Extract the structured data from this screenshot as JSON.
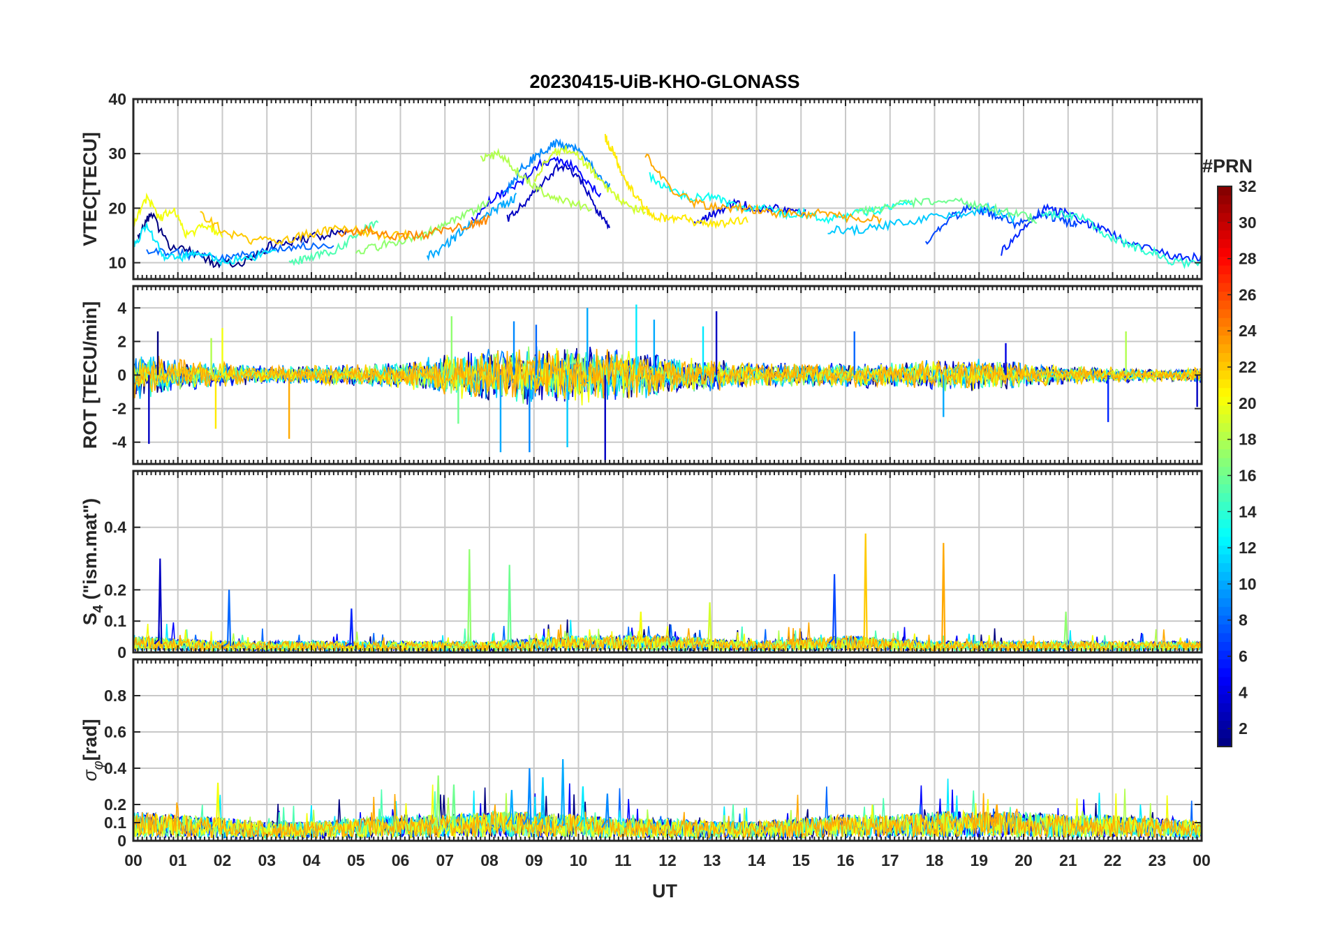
{
  "chart_data": {
    "type": "line",
    "title": "20230415-UiB-KHO-GLONASS",
    "xlabel": "UT",
    "x_tick_labels": [
      "00",
      "01",
      "02",
      "03",
      "04",
      "05",
      "06",
      "07",
      "08",
      "09",
      "10",
      "11",
      "12",
      "13",
      "14",
      "15",
      "16",
      "17",
      "18",
      "19",
      "20",
      "21",
      "22",
      "23",
      "00"
    ],
    "x_range_hours": [
      0,
      24
    ],
    "grid": true,
    "colorbar": {
      "title": "#PRN",
      "colormap": "jet",
      "range": [
        1,
        32
      ],
      "tick_labels": [
        "2",
        "4",
        "6",
        "8",
        "10",
        "12",
        "14",
        "16",
        "18",
        "20",
        "22",
        "24",
        "26",
        "28",
        "30",
        "32"
      ]
    },
    "panels": [
      {
        "ylabel": "VTEC[TECU]",
        "ylim": [
          7,
          40
        ],
        "y_ticks": [
          10,
          20,
          30,
          40
        ],
        "y_tick_labels": [
          "10",
          "20",
          "30",
          "40"
        ],
        "series": [
          {
            "prn": 1,
            "x": [
              0.1,
              0.4,
              0.8,
              1.3,
              1.8,
              2.4,
              3.0
            ],
            "y": [
              15,
              19,
              13,
              12,
              10,
              10,
              12
            ]
          },
          {
            "prn": 2,
            "x": [
              3.0,
              3.6,
              4.2,
              4.8
            ],
            "y": [
              13,
              14,
              15,
              16
            ]
          },
          {
            "prn": 3,
            "x": [
              8.4,
              8.8,
              9.2,
              9.6,
              10.0,
              10.4,
              10.7
            ],
            "y": [
              18,
              21,
              25,
              28,
              26,
              20,
              16
            ]
          },
          {
            "prn": 4,
            "x": [
              12.6,
              13.0,
              13.5,
              14.0,
              14.6,
              15.1
            ],
            "y": [
              17,
              19,
              21,
              20,
              20,
              19
            ]
          },
          {
            "prn": 5,
            "x": [
              7.6,
              8.1,
              8.6,
              9.1,
              9.6,
              10.0,
              10.5
            ],
            "y": [
              18,
              22,
              24,
              28,
              29,
              27,
              22
            ]
          },
          {
            "prn": 6,
            "x": [
              19.5,
              20.0,
              20.5,
              21.0,
              21.5,
              22.0,
              22.6,
              23.4,
              24.0
            ],
            "y": [
              12,
              16,
              20,
              19,
              17,
              15,
              13,
              11,
              11
            ]
          },
          {
            "prn": 7,
            "x": [
              17.8,
              18.3,
              18.8,
              19.3,
              19.8,
              20.3,
              20.8,
              21.2
            ],
            "y": [
              14,
              18,
              20,
              19,
              17,
              19,
              18,
              17
            ]
          },
          {
            "prn": 8,
            "x": [
              0.3,
              0.9,
              1.6,
              2.3,
              3.0,
              3.7,
              4.5
            ],
            "y": [
              12,
              12,
              11,
              11,
              12,
              13,
              13
            ]
          },
          {
            "prn": 9,
            "x": [
              8.3,
              8.7,
              9.1,
              9.5,
              9.9,
              10.3,
              10.7
            ],
            "y": [
              22,
              27,
              30,
              32,
              31,
              28,
              24
            ]
          },
          {
            "prn": 10,
            "x": [
              6.6,
              7.0,
              7.4,
              7.8,
              8.2,
              8.6
            ],
            "y": [
              11,
              13,
              16,
              18,
              20,
              22
            ]
          },
          {
            "prn": 11,
            "x": [
              15.6,
              16.3,
              17.0,
              17.7,
              18.5,
              19.2,
              19.8
            ],
            "y": [
              16,
              16,
              17,
              18,
              19,
              20,
              18
            ]
          },
          {
            "prn": 12,
            "x": [
              0.0,
              0.3,
              0.7,
              1.1,
              1.5,
              2.0,
              2.6,
              3.2
            ],
            "y": [
              13,
              17,
              11,
              11,
              12,
              10,
              11,
              12
            ]
          },
          {
            "prn": 13,
            "x": [
              11.6,
              12.1,
              12.6,
              13.1,
              13.6,
              14.1,
              14.6,
              15.1,
              15.7,
              16.3,
              16.9,
              17.5
            ],
            "y": [
              26,
              23,
              22,
              22,
              20,
              20,
              19,
              19,
              18,
              19,
              20,
              21
            ]
          },
          {
            "prn": 14,
            "x": [
              20.4,
              20.9,
              21.4,
              21.9,
              22.4,
              22.9,
              23.4,
              24.0
            ],
            "y": [
              19,
              19,
              18,
              15,
              13,
              12,
              10,
              10
            ]
          },
          {
            "prn": 15,
            "x": [
              3.5,
              4.0,
              4.5,
              5.0,
              5.5
            ],
            "y": [
              10,
              11,
              12,
              15,
              18
            ]
          },
          {
            "prn": 16,
            "x": [
              16.2,
              16.8,
              17.4,
              18.0,
              18.6,
              19.2,
              19.8,
              20.3
            ],
            "y": [
              19,
              20,
              21,
              21,
              21,
              20,
              19,
              18
            ]
          },
          {
            "prn": 17,
            "x": [
              5.0,
              5.5,
              6.0,
              6.5,
              7.0,
              7.5,
              8.0
            ],
            "y": [
              12,
              13,
              14,
              15,
              17,
              19,
              21
            ]
          },
          {
            "prn": 18,
            "x": [
              7.8,
              8.2,
              8.6,
              9.0,
              9.4,
              9.8,
              10.3
            ],
            "y": [
              29,
              30,
              27,
              24,
              22,
              21,
              20
            ]
          },
          {
            "prn": 19,
            "x": [
              9.0,
              9.4,
              9.8,
              10.2,
              10.6,
              11.0,
              11.5
            ],
            "y": [
              25,
              30,
              31,
              28,
              24,
              21,
              19
            ]
          },
          {
            "prn": 20,
            "x": [
              0.0,
              0.3,
              0.6,
              0.9,
              1.2,
              1.6,
              2.0
            ],
            "y": [
              17,
              22,
              18,
              20,
              15,
              17,
              15
            ]
          },
          {
            "prn": 21,
            "x": [
              10.6,
              10.8,
              11.0,
              11.3,
              11.6,
              12.0,
              12.4,
              12.8,
              13.2,
              13.8
            ],
            "y": [
              33,
              30,
              26,
              22,
              19,
              18,
              18,
              17,
              17,
              18
            ]
          },
          {
            "prn": 22,
            "x": [
              1.5,
              2.0,
              2.6,
              3.2,
              3.8,
              4.4,
              5.0,
              5.6,
              6.2
            ],
            "y": [
              19,
              16,
              14,
              14,
              15,
              16,
              16,
              15,
              15
            ]
          },
          {
            "prn": 23,
            "x": [
              11.5,
              12.0,
              12.6,
              13.2,
              13.8,
              14.4,
              15.0,
              15.6,
              16.2,
              16.8
            ],
            "y": [
              30,
              24,
              21,
              20,
              20,
              19,
              19,
              19,
              18,
              18
            ]
          },
          {
            "prn": 24,
            "x": [
              4.6,
              5.2,
              5.8,
              6.4,
              7.0,
              7.6,
              8.0
            ],
            "y": [
              15,
              16,
              15,
              15,
              16,
              17,
              18
            ]
          }
        ]
      },
      {
        "ylabel": "ROT [TECU/min]",
        "ylim": [
          -5.3,
          5.3
        ],
        "y_ticks": [
          -4,
          -2,
          0,
          2,
          4
        ],
        "y_tick_labels": [
          "-4",
          "-2",
          "0",
          "2",
          "4"
        ],
        "noise_envelope": [
          [
            0,
            1.6
          ],
          [
            1,
            1.0
          ],
          [
            2,
            0.8
          ],
          [
            3,
            0.6
          ],
          [
            4,
            0.6
          ],
          [
            5,
            0.7
          ],
          [
            6,
            0.8
          ],
          [
            7,
            1.3
          ],
          [
            8,
            1.7
          ],
          [
            9,
            1.9
          ],
          [
            10,
            1.9
          ],
          [
            11,
            1.7
          ],
          [
            12,
            1.3
          ],
          [
            13,
            1.0
          ],
          [
            14,
            0.8
          ],
          [
            15,
            0.8
          ],
          [
            16,
            0.8
          ],
          [
            17,
            0.8
          ],
          [
            18,
            1.0
          ],
          [
            19,
            1.0
          ],
          [
            20,
            0.8
          ],
          [
            21,
            0.6
          ],
          [
            22,
            0.5
          ],
          [
            23,
            0.4
          ],
          [
            24,
            0.5
          ]
        ],
        "spikes": [
          {
            "t": 0.35,
            "v": -4.1,
            "prn": 3
          },
          {
            "t": 0.55,
            "v": 2.6,
            "prn": 1
          },
          {
            "t": 1.75,
            "v": 2.2,
            "prn": 18
          },
          {
            "t": 1.85,
            "v": -3.2,
            "prn": 21
          },
          {
            "t": 2.0,
            "v": 2.8,
            "prn": 20
          },
          {
            "t": 3.5,
            "v": -3.8,
            "prn": 23
          },
          {
            "t": 7.15,
            "v": 3.5,
            "prn": 17
          },
          {
            "t": 7.3,
            "v": -2.9,
            "prn": 16
          },
          {
            "t": 8.25,
            "v": -4.6,
            "prn": 10
          },
          {
            "t": 8.55,
            "v": 3.2,
            "prn": 9
          },
          {
            "t": 8.9,
            "v": -4.6,
            "prn": 9
          },
          {
            "t": 9.05,
            "v": 3.0,
            "prn": 8
          },
          {
            "t": 9.75,
            "v": -4.3,
            "prn": 11
          },
          {
            "t": 10.2,
            "v": 4.0,
            "prn": 10
          },
          {
            "t": 10.6,
            "v": -5.2,
            "prn": 3
          },
          {
            "t": 11.3,
            "v": 4.2,
            "prn": 12
          },
          {
            "t": 11.7,
            "v": 3.3,
            "prn": 10
          },
          {
            "t": 12.8,
            "v": 2.9,
            "prn": 12
          },
          {
            "t": 13.1,
            "v": 3.8,
            "prn": 3
          },
          {
            "t": 16.2,
            "v": 2.6,
            "prn": 8
          },
          {
            "t": 18.2,
            "v": -2.5,
            "prn": 10
          },
          {
            "t": 19.6,
            "v": 1.9,
            "prn": 4
          },
          {
            "t": 21.9,
            "v": -2.8,
            "prn": 6
          },
          {
            "t": 22.3,
            "v": 2.6,
            "prn": 18
          },
          {
            "t": 23.9,
            "v": -1.9,
            "prn": 3
          }
        ]
      },
      {
        "ylabel": "S4 (\"ism.mat\")",
        "ylabel_main": "S",
        "ylabel_subscript": "4",
        "ylabel_rest": " (\"ism.mat\")",
        "ylim": [
          0,
          0.58
        ],
        "y_ticks": [
          0,
          0.1,
          0.2,
          0.4
        ],
        "y_tick_labels": [
          "0",
          "0.1",
          "0.2",
          "0.4"
        ],
        "baseline": [
          [
            0,
            0.03
          ],
          [
            2,
            0.02
          ],
          [
            4,
            0.02
          ],
          [
            6,
            0.02
          ],
          [
            8,
            0.02
          ],
          [
            10,
            0.03
          ],
          [
            12,
            0.03
          ],
          [
            14,
            0.02
          ],
          [
            16,
            0.03
          ],
          [
            18,
            0.02
          ],
          [
            20,
            0.02
          ],
          [
            22,
            0.02
          ],
          [
            24,
            0.02
          ]
        ],
        "spikes": [
          {
            "t": 0.6,
            "v": 0.3,
            "prn": 3
          },
          {
            "t": 2.15,
            "v": 0.2,
            "prn": 8
          },
          {
            "t": 4.9,
            "v": 0.14,
            "prn": 6
          },
          {
            "t": 7.55,
            "v": 0.33,
            "prn": 17
          },
          {
            "t": 8.45,
            "v": 0.28,
            "prn": 16
          },
          {
            "t": 11.4,
            "v": 0.13,
            "prn": 20
          },
          {
            "t": 12.95,
            "v": 0.16,
            "prn": 19
          },
          {
            "t": 15.75,
            "v": 0.25,
            "prn": 7
          },
          {
            "t": 16.45,
            "v": 0.38,
            "prn": 22
          },
          {
            "t": 18.2,
            "v": 0.35,
            "prn": 23
          },
          {
            "t": 20.95,
            "v": 0.13,
            "prn": 17
          }
        ]
      },
      {
        "ylabel": "σφ[rad]",
        "ylabel_main": "σ",
        "ylabel_subscript": "φ",
        "ylabel_rest": "[rad]",
        "ylim": [
          0,
          1.0
        ],
        "y_ticks": [
          0,
          0.1,
          0.2,
          0.4,
          0.6,
          0.8
        ],
        "y_tick_labels": [
          "0",
          "0.1",
          "0.2",
          "0.4",
          "0.6",
          "0.8"
        ],
        "baseline": [
          [
            0,
            0.09
          ],
          [
            1,
            0.08
          ],
          [
            2,
            0.07
          ],
          [
            3,
            0.06
          ],
          [
            4,
            0.06
          ],
          [
            5,
            0.07
          ],
          [
            6,
            0.08
          ],
          [
            7,
            0.08
          ],
          [
            8,
            0.09
          ],
          [
            9,
            0.09
          ],
          [
            10,
            0.08
          ],
          [
            11,
            0.07
          ],
          [
            12,
            0.07
          ],
          [
            13,
            0.06
          ],
          [
            14,
            0.06
          ],
          [
            15,
            0.07
          ],
          [
            16,
            0.08
          ],
          [
            17,
            0.08
          ],
          [
            18,
            0.09
          ],
          [
            19,
            0.09
          ],
          [
            20,
            0.09
          ],
          [
            21,
            0.08
          ],
          [
            22,
            0.08
          ],
          [
            23,
            0.07
          ],
          [
            24,
            0.06
          ]
        ],
        "spikes": [
          {
            "t": 1.9,
            "v": 0.32,
            "prn": 20
          },
          {
            "t": 6.85,
            "v": 0.36,
            "prn": 17
          },
          {
            "t": 7.2,
            "v": 0.31,
            "prn": 16
          },
          {
            "t": 8.5,
            "v": 0.28,
            "prn": 10
          },
          {
            "t": 8.9,
            "v": 0.4,
            "prn": 9
          },
          {
            "t": 9.2,
            "v": 0.35,
            "prn": 11
          },
          {
            "t": 9.65,
            "v": 0.45,
            "prn": 10
          },
          {
            "t": 10.1,
            "v": 0.3,
            "prn": 12
          },
          {
            "t": 10.65,
            "v": 0.26,
            "prn": 9
          },
          {
            "t": 19.4,
            "v": 0.2,
            "prn": 23
          }
        ]
      }
    ]
  }
}
